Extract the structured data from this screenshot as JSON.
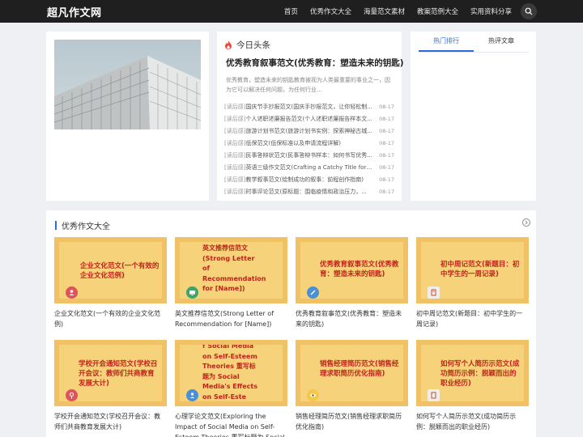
{
  "site": {
    "logo": "超凡作文网"
  },
  "nav": {
    "items": [
      "首页",
      "优秀作文大全",
      "海量范文素材",
      "教案范例大全",
      "实用资料分享"
    ]
  },
  "headline": {
    "section_title": "今日头条",
    "feature_title": "优秀教育叙事范文(优秀教育：塑造未来的钥匙)",
    "feature_desc": "优秀教育，塑造未来的钥匙教育被视为人类最重要的事业之一，因为它可以解决任何问题，为任何行业...",
    "list": [
      {
        "tag": "[读后感]",
        "title": "国庆节手抄报范文(国庆手抄报范文，让你轻松制...",
        "date": "08-17"
      },
      {
        "tag": "[读后感]",
        "title": "个人述职述廉报告范文(个人述职述廉报告样本文...",
        "date": "08-17"
      },
      {
        "tag": "[读后感]",
        "title": "旅游计划书范文(旅游计划书实例：探索神秘古城...",
        "date": "08-17"
      },
      {
        "tag": "[读后感]",
        "title": "低保范文(低保标准以及申请流程详解)",
        "date": "08-17"
      },
      {
        "tag": "[读后感]",
        "title": "民事答辩状范文(民事答辩书样本：如何书写优秀...",
        "date": "08-17"
      },
      {
        "tag": "[读后感]",
        "title": "英语三级作文范文(Crafting a Catchy Title for an ...",
        "date": "08-17"
      },
      {
        "tag": "[读后感]",
        "title": "教学叙事范文(绘制成功的叙事：前程创作指南)",
        "date": "08-17"
      },
      {
        "tag": "[读后感]",
        "title": "时事评论范文(原标题：围临疫情和政治压力，...",
        "date": "08-17"
      }
    ]
  },
  "side_tabs": {
    "active": "热门排行",
    "other": "热评文章"
  },
  "section": {
    "title": "优秀作文大全"
  },
  "colors": {
    "accent": "#2b6cd9",
    "thumb_bg": "#f6d586",
    "thumb_text": "#c0231c"
  },
  "cards": [
    {
      "thumb_title": "企业文化范文(一个有效的企业文化范例)",
      "caption": "企业文化范文(一个有效的企业文化范例)",
      "icon": "person-icon",
      "icon_color": "#e0525c"
    },
    {
      "thumb_title": "英文推荐信范文(Strong Letter of Recommendation for [Name])",
      "caption": "英文推荐信范文(Strong Letter of Recommendation for [Name])",
      "icon": "screen-icon",
      "icon_color": "#3fa36a"
    },
    {
      "thumb_title": "优秀教育叙事范文(优秀教育：塑造未来的钥匙)",
      "caption": "优秀教育叙事范文(优秀教育：塑造未来的钥匙)",
      "icon": "pen-icon",
      "icon_color": "#4a90d9"
    },
    {
      "thumb_title": "初中周记范文(新题目：初中学生的一周记录)",
      "caption": "初中周记范文(新题目：初中学生的一周记录)",
      "icon": "notebook-icon",
      "icon_color": "#f0eee8"
    },
    {
      "thumb_title": "学校开会通知范文(学校召开会议：教师们共商教育发展大计)",
      "caption": "学校开会通知范文(学校召开会议：教师们共商教育发展大计)",
      "icon": "female-icon",
      "icon_color": "#e0525c"
    },
    {
      "thumb_title": "f Social Media on Self-Esteem Theories 重写标题为 Social Media's Effects on Self-Este",
      "caption": "心理学论文范文(Exploring the Impact of Social Media on Self-Esteem Theories 重写标题为 Social Media's",
      "icon": "people-icon",
      "icon_color": "#4a90d9"
    },
    {
      "thumb_title": "销售经理简历范文(销售经理求职简历优化指南)",
      "caption": "销售经理简历范文(销售经理求职简历优化指南)",
      "icon": "eye-icon",
      "icon_color": "#f4c84a"
    },
    {
      "thumb_title": "如何写个人简历示范文(成功简历示例：脱颖而出的职业经历)",
      "caption": "如何写个人简历示范文(成功简历示例：脱颖而出的职业经历)",
      "icon": "document-icon",
      "icon_color": "#f0eee8"
    }
  ]
}
